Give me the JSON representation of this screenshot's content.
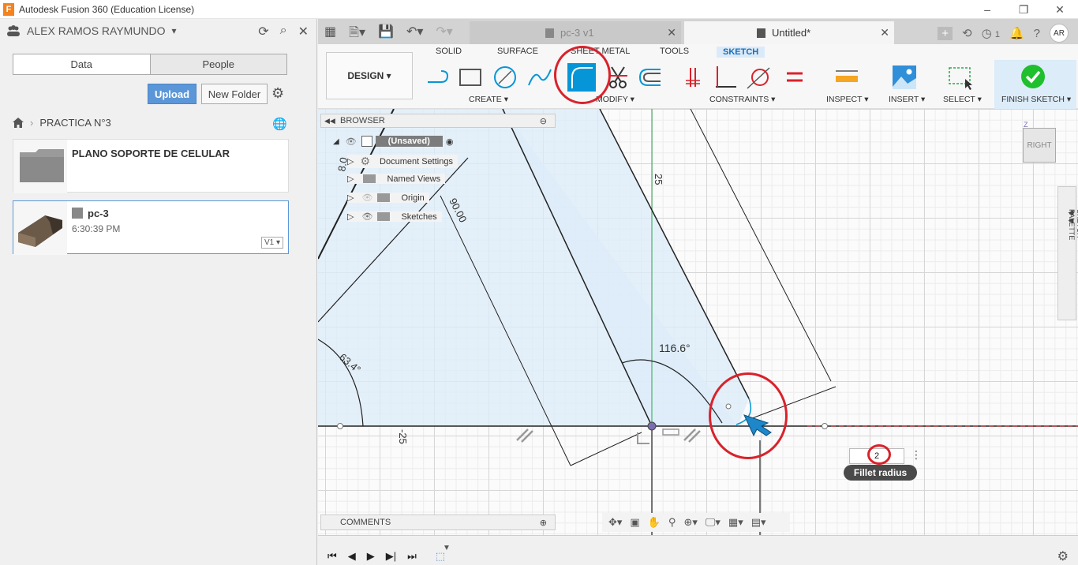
{
  "window": {
    "title": "Autodesk Fusion 360 (Education License)",
    "logo": "F"
  },
  "data_panel": {
    "user": "ALEX RAMOS RAYMUNDO",
    "tabs": [
      "Data",
      "People"
    ],
    "upload_label": "Upload",
    "new_folder_label": "New Folder",
    "breadcrumb": "PRACTICA N°3",
    "folder_card": {
      "name": "PLANO SOPORTE DE CELULAR"
    },
    "file_card": {
      "name": "pc-3",
      "time": "6:30:39 PM",
      "version": "V1"
    }
  },
  "doc_tabs": [
    {
      "label": "pc-3 v1",
      "active": false
    },
    {
      "label": "Untitled*",
      "active": true
    }
  ],
  "header_right": {
    "job_count": "1",
    "avatar": "AR"
  },
  "toolbar": {
    "workspace": "DESIGN",
    "ws_tabs": [
      "SOLID",
      "SURFACE",
      "SHEET METAL",
      "TOOLS",
      "SKETCH"
    ],
    "active_ws_tab": "SKETCH",
    "groups": [
      "CREATE",
      "MODIFY",
      "CONSTRAINTS",
      "INSPECT",
      "INSERT",
      "SELECT",
      "FINISH SKETCH"
    ]
  },
  "browser": {
    "title": "BROWSER",
    "root": "(Unsaved)",
    "items": [
      "Document Settings",
      "Named Views",
      "Origin",
      "Sketches"
    ]
  },
  "comments_label": "COMMENTS",
  "viewcube_label": "RIGHT",
  "sketch_palette_label": "SKETCH PALETTE",
  "dimensions": {
    "d1": "25",
    "d2": "90.00",
    "d3": "-25",
    "angle1": "116.6°",
    "angle2": "63.4°",
    "d4": "8.0"
  },
  "fillet": {
    "value": "2",
    "tooltip": "Fillet radius"
  },
  "colors": {
    "accent": "#0696d7",
    "highlight": "#d9222b",
    "finish": "#1fbf2d"
  }
}
